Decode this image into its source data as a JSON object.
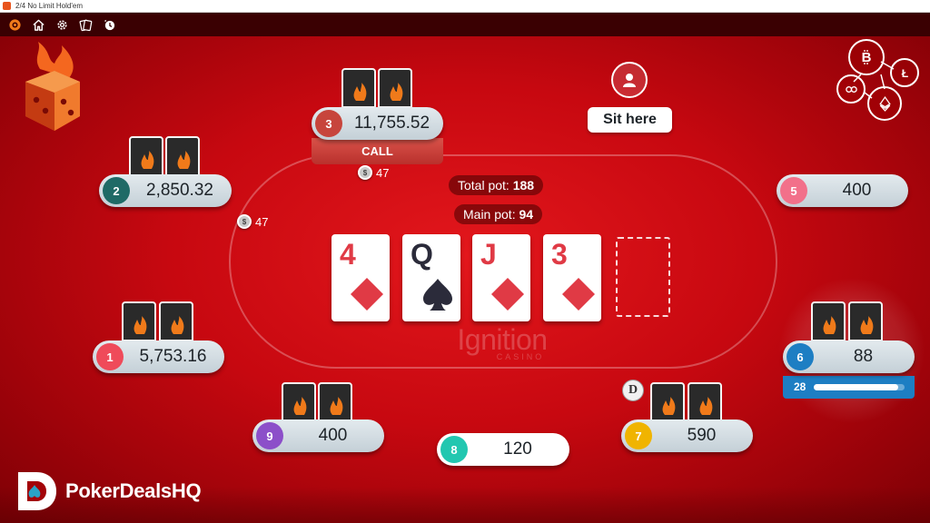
{
  "window": {
    "title": "2/4 No Limit Hold'em"
  },
  "toolbar": {
    "icons": [
      "menu-icon",
      "home-icon",
      "gear-icon",
      "cards-icon",
      "time-icon"
    ]
  },
  "pots": {
    "total_label": "Total pot:",
    "total_value": "188",
    "main_label": "Main pot:",
    "main_value": "94"
  },
  "board": [
    {
      "rank": "4",
      "suit": "diamonds"
    },
    {
      "rank": "Q",
      "suit": "spades"
    },
    {
      "rank": "J",
      "suit": "diamonds"
    },
    {
      "rank": "3",
      "suit": "diamonds"
    }
  ],
  "seats": {
    "s1": {
      "num": "1",
      "stack": "5,753.16"
    },
    "s2": {
      "num": "2",
      "stack": "2,850.32"
    },
    "s3": {
      "num": "3",
      "stack": "11,755.52",
      "action": "CALL"
    },
    "s5": {
      "num": "5",
      "stack": "400"
    },
    "s6": {
      "num": "6",
      "stack": "88",
      "timer": "28",
      "timer_fraction": 0.93
    },
    "s7": {
      "num": "7",
      "stack": "590"
    },
    "s8": {
      "num": "8",
      "stack": "120"
    },
    "s9": {
      "num": "9",
      "stack": "400"
    }
  },
  "bets": {
    "seat2": "47",
    "seat3": "47"
  },
  "chip_glyph": "$",
  "sit_here": "Sit here",
  "dealer": "D",
  "casino_watermark": {
    "line1": "Ignition",
    "line2": "CASINO"
  },
  "watermark": "PokerDealsHQ",
  "colors": {
    "seat1": "#ef4b5a",
    "seat2": "#1f6a66",
    "seat3": "#c7453c",
    "seat5": "#f2708a",
    "seat6": "#1d7ec3",
    "seat7": "#f0b400",
    "seat8": "#22c7b0",
    "seat9": "#8c4fc9",
    "brand": "#e8541d",
    "felt": "#c70810"
  }
}
